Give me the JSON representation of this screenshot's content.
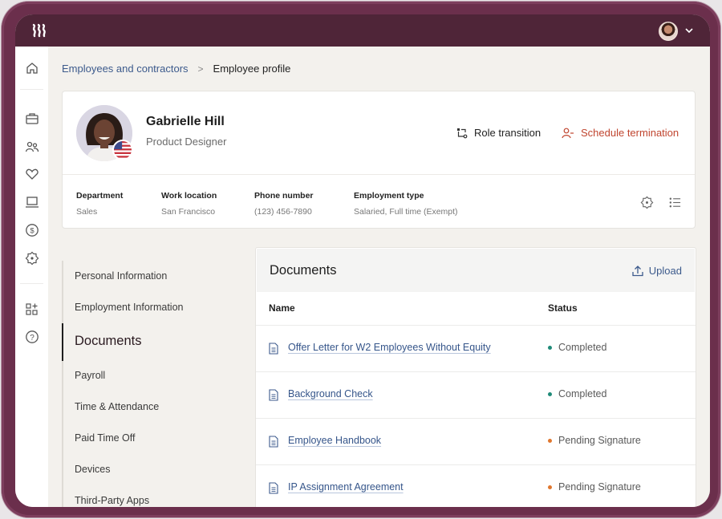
{
  "app": {
    "logo_icon": "rippling-logo-icon",
    "user_menu_icon": "chevron-down-icon"
  },
  "rail": {
    "items": [
      {
        "icon": "home-icon"
      },
      {
        "icon": "briefcase-icon"
      },
      {
        "icon": "people-icon"
      },
      {
        "icon": "heart-icon"
      },
      {
        "icon": "laptop-icon"
      },
      {
        "icon": "dollar-icon"
      },
      {
        "icon": "settings-icon"
      },
      {
        "icon": "apps-add-icon"
      },
      {
        "icon": "help-icon"
      }
    ]
  },
  "breadcrumb": {
    "parent": "Employees and contractors",
    "separator": ">",
    "current": "Employee profile"
  },
  "profile": {
    "name": "Gabrielle Hill",
    "title": "Product Designer",
    "country_flag": "us-flag-icon",
    "actions": {
      "role_transition": "Role transition",
      "schedule_termination": "Schedule termination"
    },
    "fields": [
      {
        "label": "Department",
        "value": "Sales"
      },
      {
        "label": "Work location",
        "value": "San Francisco"
      },
      {
        "label": "Phone number",
        "value": "(123) 456-7890"
      },
      {
        "label": "Employment type",
        "value": "Salaried, Full time (Exempt)"
      }
    ]
  },
  "subnav": {
    "items": [
      {
        "label": "Personal Information",
        "active": false
      },
      {
        "label": "Employment Information",
        "active": false
      },
      {
        "label": "Documents",
        "active": true
      },
      {
        "label": "Payroll",
        "active": false
      },
      {
        "label": "Time & Attendance",
        "active": false
      },
      {
        "label": "Paid Time Off",
        "active": false
      },
      {
        "label": "Devices",
        "active": false
      },
      {
        "label": "Third-Party Apps",
        "active": false
      }
    ]
  },
  "documents": {
    "heading": "Documents",
    "upload_label": "Upload",
    "columns": {
      "name": "Name",
      "status": "Status"
    },
    "status_colors": {
      "Completed": "#1f8a78",
      "Pending Signature": "#e0772e"
    },
    "rows": [
      {
        "name": "Offer Letter for W2 Employees Without Equity",
        "status": "Completed"
      },
      {
        "name": "Background Check",
        "status": "Completed"
      },
      {
        "name": "Employee Handbook",
        "status": "Pending Signature"
      },
      {
        "name": "IP Assignment Agreement",
        "status": "Pending Signature"
      }
    ]
  },
  "colors": {
    "frame": "#6b2f4c",
    "topbar": "#4f2538",
    "link": "#3c5a8c",
    "danger": "#c0452f"
  }
}
